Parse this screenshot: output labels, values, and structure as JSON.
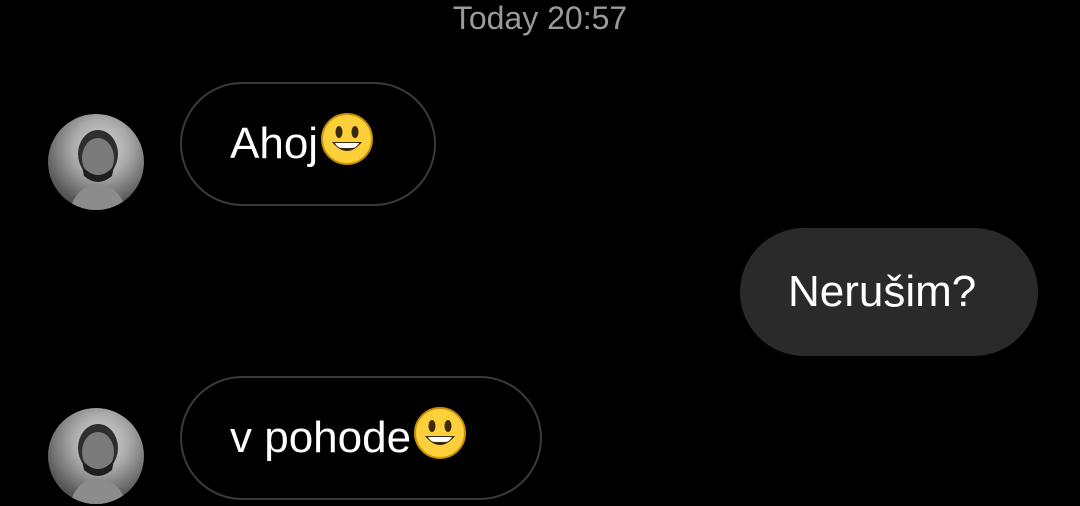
{
  "timestamp": "Today 20:57",
  "messages": [
    {
      "direction": "incoming",
      "text": "Ahoj",
      "emoji": "smiling-face-emoji"
    },
    {
      "direction": "outgoing",
      "text": "Nerušim?"
    },
    {
      "direction": "incoming",
      "text": "v pohode",
      "emoji": "smiling-face-emoji"
    }
  ],
  "colors": {
    "background": "#000000",
    "incoming_border": "#3a3a3a",
    "outgoing_bubble": "#2a2a2a",
    "timestamp": "#9a9a9a",
    "text": "#ffffff"
  }
}
